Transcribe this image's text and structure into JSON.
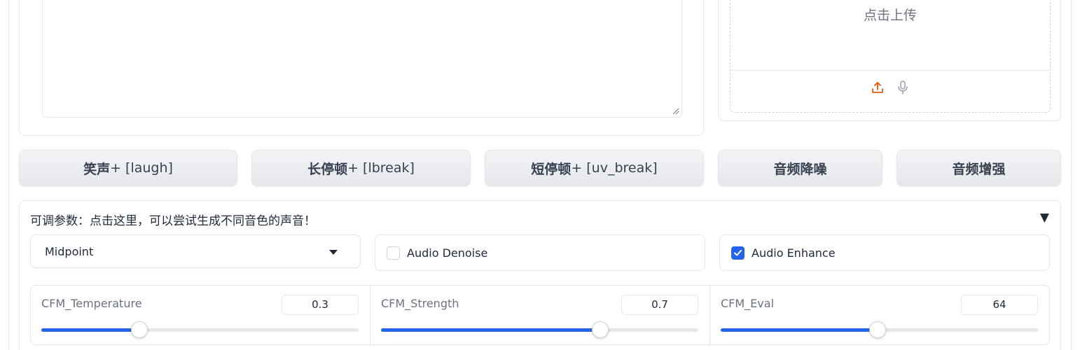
{
  "upload": {
    "prompt": "点击上传",
    "icons": [
      "upload-icon",
      "microphone-icon"
    ]
  },
  "buttons": [
    {
      "main": "笑声",
      "tag": " + [laugh]"
    },
    {
      "main": "长停顿",
      "tag": " + [lbreak]"
    },
    {
      "main": "短停顿",
      "tag": " + [uv_break]"
    },
    {
      "main": "音频降噪",
      "tag": ""
    },
    {
      "main": "音频增强",
      "tag": ""
    }
  ],
  "params": {
    "title": "可调参数：点击这里，可以尝试生成不同音色的声音！",
    "toggle": "▼",
    "select_value": "Midpoint",
    "denoise_label": "Audio Denoise",
    "denoise_checked": false,
    "enhance_label": "Audio Enhance",
    "enhance_checked": true
  },
  "sliders": [
    {
      "label": "CFM_Temperature",
      "value": "0.3",
      "fraction": 0.31
    },
    {
      "label": "CFM_Strength",
      "value": "0.7",
      "fraction": 0.69
    },
    {
      "label": "CFM_Eval",
      "value": "64",
      "fraction": 0.495
    }
  ],
  "colors": {
    "accent": "#2563eb",
    "upload_icon": "#ea580c"
  }
}
